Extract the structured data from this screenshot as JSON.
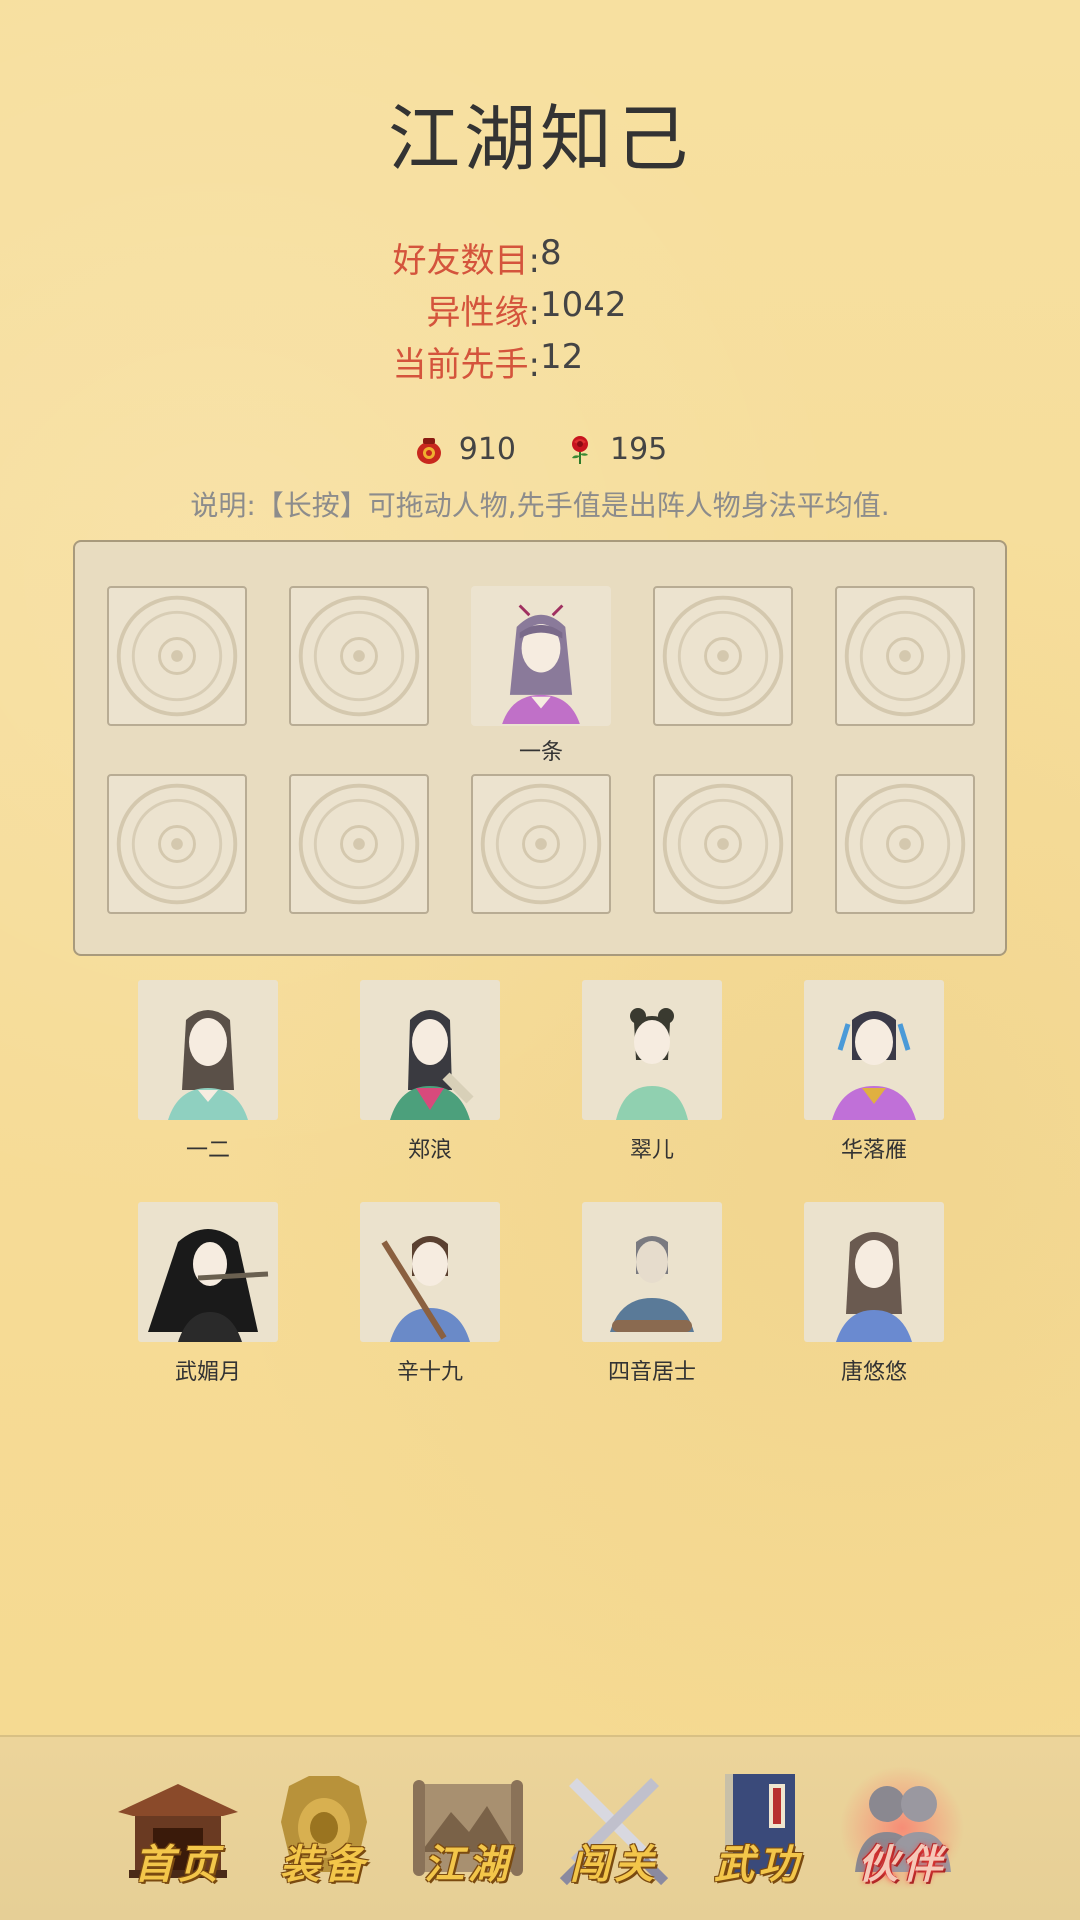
{
  "page_title": "江湖知己",
  "stats": [
    {
      "label": "好友数目",
      "value": "8"
    },
    {
      "label": "异性缘",
      "value": "1042"
    },
    {
      "label": "当前先手",
      "value": "12"
    }
  ],
  "resources": [
    {
      "icon": "red-jar-icon",
      "value": "910"
    },
    {
      "icon": "red-rose-icon",
      "value": "195"
    }
  ],
  "note": "说明:【长按】可拖动人物,先手值是出阵人物身法平均值.",
  "formation": {
    "occupied_slot_name": "一条"
  },
  "roster": [
    {
      "name": "一二"
    },
    {
      "name": "郑浪"
    },
    {
      "name": "翠儿"
    },
    {
      "name": "华落雁"
    },
    {
      "name": "武媚月"
    },
    {
      "name": "辛十九"
    },
    {
      "name": "四音居士"
    },
    {
      "name": "唐悠悠"
    }
  ],
  "nav": [
    {
      "label": "首页",
      "icon": "pavilion-icon"
    },
    {
      "label": "装备",
      "icon": "armor-icon"
    },
    {
      "label": "江湖",
      "icon": "scroll-map-icon"
    },
    {
      "label": "闯关",
      "icon": "crossed-swords-icon"
    },
    {
      "label": "武功",
      "icon": "martial-book-icon"
    },
    {
      "label": "伙伴",
      "icon": "companions-icon"
    }
  ],
  "colors": {
    "stat_label": "#d4543c",
    "nav_label": "#f3c64a",
    "active_glow": "#ff4040"
  }
}
